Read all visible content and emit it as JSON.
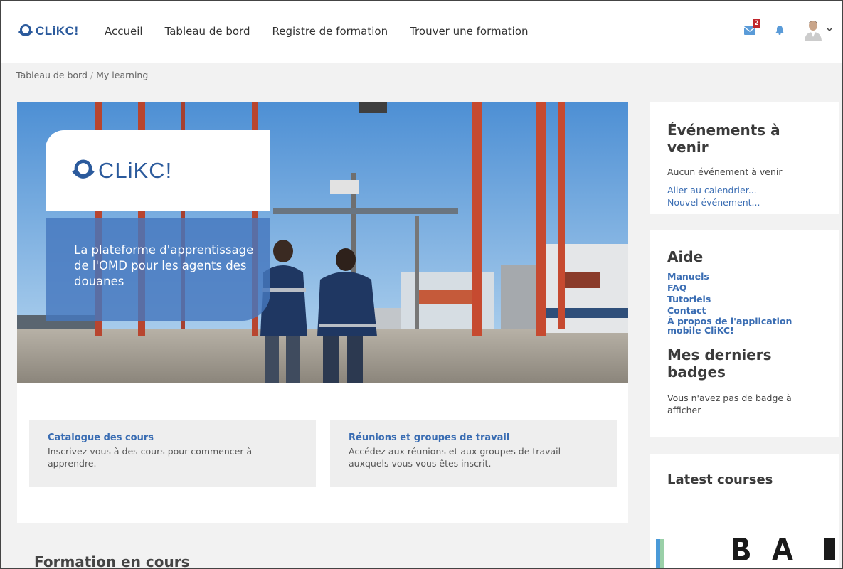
{
  "app": {
    "brand": "CLiKC!"
  },
  "nav": {
    "items": [
      {
        "label": "Accueil"
      },
      {
        "label": "Tableau de bord"
      },
      {
        "label": "Registre de formation"
      },
      {
        "label": "Trouver une formation"
      }
    ],
    "messages_count": "2"
  },
  "breadcrumb": {
    "items": [
      "Tableau de bord",
      "My learning"
    ]
  },
  "hero": {
    "logo": "CLiKC!",
    "tagline": "La plateforme d'apprentissage de l'OMD pour les agents des douanes"
  },
  "quick_links": [
    {
      "title": "Catalogue des cours",
      "description": "Inscrivez-vous à des cours pour commencer à apprendre."
    },
    {
      "title": "Réunions et groupes de travail",
      "description": "Accédez aux réunions et aux groupes de travail auxquels vous vous êtes inscrit."
    }
  ],
  "main": {
    "section_title": "Formation en cours"
  },
  "sidebar": {
    "events": {
      "title": "Événements à venir",
      "empty": "Aucun événement à venir",
      "calendar_link": "Aller au calendrier...",
      "new_event_link": "Nouvel événement..."
    },
    "help": {
      "title": "Aide",
      "links": [
        "Manuels",
        "FAQ",
        "Tutoriels",
        "Contact",
        "À propos de l'application mobile CliKC!"
      ]
    },
    "badges": {
      "title": "Mes derniers badges",
      "empty": "Vous n'avez pas de badge à afficher"
    },
    "latest": {
      "title": "Latest courses"
    }
  },
  "colors": {
    "accent": "#3a6db3",
    "brand": "#2b5a9c",
    "badge": "#c0272d"
  }
}
